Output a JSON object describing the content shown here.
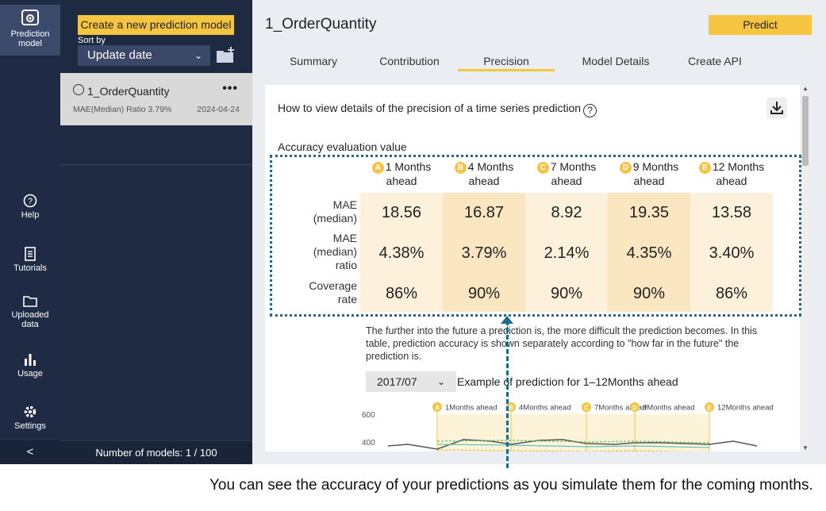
{
  "nav": {
    "prediction_model": "Prediction model",
    "help": "Help",
    "tutorials": "Tutorials",
    "uploaded_data": "Uploaded data",
    "usage": "Usage",
    "settings": "Settings",
    "collapse": "<"
  },
  "sidebar": {
    "create_button": "Create a new prediction model",
    "sort_by_label": "Sort by",
    "sort_value": "Update date",
    "model": {
      "name": "1_OrderQuantity",
      "menu": "•••",
      "metric": "MAE(Median) Ratio 3.79%",
      "date": "2024-04-24"
    },
    "footer": "Number of models: 1 / 100"
  },
  "main": {
    "title": "1_OrderQuantity",
    "predict_button": "Predict",
    "tabs": [
      "Summary",
      "Contribution",
      "Precision",
      "Model Details",
      "Create API"
    ],
    "active_tab": "Precision"
  },
  "panel": {
    "howto": "How to view details of the precision of a time series prediction",
    "help_glyph": "?",
    "accuracy_label": "Accuracy evaluation value",
    "columns": [
      {
        "badge": "A",
        "line1": "1 Months",
        "line2": "ahead"
      },
      {
        "badge": "B",
        "line1": "4 Months",
        "line2": "ahead"
      },
      {
        "badge": "C",
        "line1": "7 Months",
        "line2": "ahead"
      },
      {
        "badge": "D",
        "line1": "9 Months",
        "line2": "ahead"
      },
      {
        "badge": "E",
        "line1": "12 Months",
        "line2": "ahead"
      }
    ],
    "rows": [
      {
        "label1": "MAE",
        "label2": "(median)",
        "label3": "",
        "values": [
          "18.56",
          "16.87",
          "8.92",
          "19.35",
          "13.58"
        ]
      },
      {
        "label1": "MAE",
        "label2": "(median)",
        "label3": "ratio",
        "values": [
          "4.38%",
          "3.79%",
          "2.14%",
          "4.35%",
          "3.40%"
        ]
      },
      {
        "label1": "Coverage",
        "label2": "rate",
        "label3": "",
        "values": [
          "86%",
          "90%",
          "90%",
          "90%",
          "86%"
        ]
      }
    ],
    "explanation": "The further into the future a prediction is, the more difficult the prediction becomes. In this table, prediction accuracy is shown separately according to \"how far in the future\" the prediction is.",
    "date_value": "2017/07",
    "example_label": "Example of prediction for 1–12Months ahead",
    "mini_chart": {
      "y_ticks": [
        "600",
        "400"
      ],
      "markers": [
        {
          "badge": "A",
          "label": "1Months ahead"
        },
        {
          "badge": "B",
          "label": "4Months ahead"
        },
        {
          "badge": "C",
          "label": "7Months ahead"
        },
        {
          "badge": "D",
          "label": "9Months ahead"
        },
        {
          "badge": "E",
          "label": "12Months ahead"
        }
      ]
    }
  },
  "caption": "You can see the accuracy of your predictions as you simulate them for the coming months.",
  "colors": {
    "accent": "#f5c542",
    "nav_bg": "#1f2a44",
    "callout": "#1b6a8f"
  }
}
